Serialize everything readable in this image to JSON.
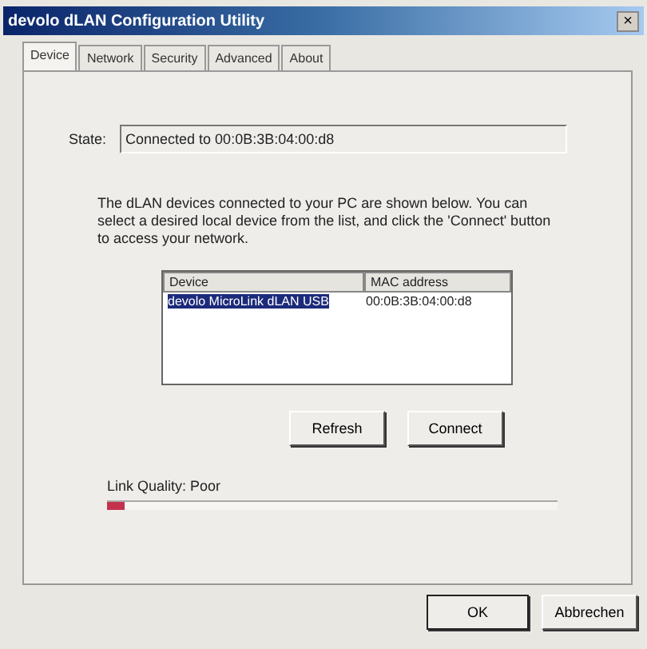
{
  "window": {
    "title": "devolo dLAN Configuration Utility",
    "close": "×"
  },
  "tabs": [
    {
      "label": "Device",
      "selected": true
    },
    {
      "label": "Network",
      "selected": false
    },
    {
      "label": "Security",
      "selected": false
    },
    {
      "label": "Advanced",
      "selected": false
    },
    {
      "label": "About",
      "selected": false
    }
  ],
  "state": {
    "label": "State:",
    "value": "Connected to 00:0B:3B:04:00:d8"
  },
  "description": "The dLAN devices connected to your PC are shown below. You can select a desired local device from the list, and click the 'Connect' button to access your network.",
  "device_list": {
    "columns": [
      "Device",
      "MAC address"
    ],
    "rows": [
      {
        "cells": [
          "devolo MicroLink dLAN USB",
          "00:0B:3B:04:00:d8"
        ],
        "selected": true
      }
    ]
  },
  "actions": [
    "Refresh",
    "Connect"
  ],
  "link_quality": {
    "label": "Link Quality: Poor",
    "level": 0.04
  },
  "buttons": [
    "OK",
    "Abbrechen"
  ]
}
